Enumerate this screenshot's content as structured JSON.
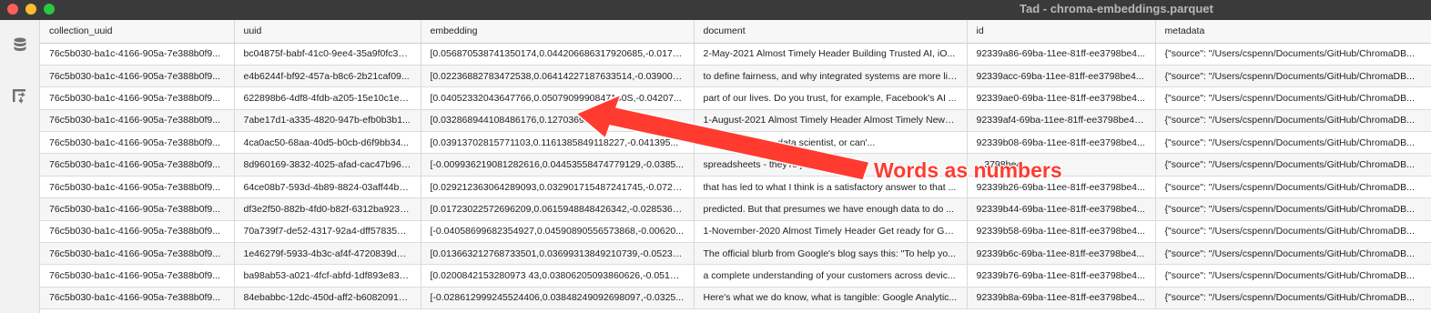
{
  "window": {
    "title": "Tad - chroma-embeddings.parquet"
  },
  "sidebar": {
    "icons": [
      "database-icon",
      "pivot-icon"
    ]
  },
  "table": {
    "columns": [
      "collection_uuid",
      "uuid",
      "embedding",
      "document",
      "id",
      "metadata"
    ],
    "rows": [
      [
        "76c5b030-ba1c-4166-905a-7e388b0f9...",
        "bc04875f-babf-41c0-9ee4-35a9f0fc33ea",
        "[0.056870538741350174,0.044206686317920685,-0.0179...",
        "2-May-2021 Almost Timely Header Building Trusted AI, iO...",
        "92339a86-69ba-11ee-81ff-ee3798be4...",
        "{\"source\": \"/Users/cspenn/Documents/GitHub/ChromaDB..."
      ],
      [
        "76c5b030-ba1c-4166-905a-7e388b0f9...",
        "e4b6244f-bf92-457a-b8c6-2b21caf09...",
        "[0.02236882783472538,0.06414227187633514,-0.039009...",
        "to define fairness, and why integrated systems are more lik...",
        "92339acc-69ba-11ee-81ff-ee3798be4...",
        "{\"source\": \"/Users/cspenn/Documents/GitHub/ChromaDB..."
      ],
      [
        "76c5b030-ba1c-4166-905a-7e388b0f9...",
        "622898b6-4df8-4fdb-a205-15e10c1e3...",
        "[0.04052332043647766,0.0507909990847140S,-0.04207...",
        "part of our lives. Do you trust, for example, Facebook's AI ...",
        "92339ae0-69ba-11ee-81ff-ee3798be4...",
        "{\"source\": \"/Users/cspenn/Documents/GitHub/ChromaDB..."
      ],
      [
        "76c5b030-ba1c-4166-905a-7e388b0f9...",
        "7abe17d1-a335-4820-947b-efb0b3b1...",
        "[0.032868944108486176,0.12703691...",
        "1-August-2021 Almost Timely Header Almost Timely News...",
        "92339af4-69ba-11ee-81ff-ee3798be4d...",
        "{\"source\": \"/Users/cspenn/Documents/GitHub/ChromaDB..."
      ],
      [
        "76c5b030-ba1c-4166-905a-7e388b0f9...",
        "4ca0ac50-68aa-40d5-b0cb-d6f9bb34...",
        "[0.03913702815771103,0.1161385849118227,-0.041395...",
        "...engineer and a data scientist, or can'...",
        "92339b08-69ba-11ee-81ff-ee3798be4...",
        "{\"source\": \"/Users/cspenn/Documents/GitHub/ChromaDB..."
      ],
      [
        "76c5b030-ba1c-4166-905a-7e388b0f9...",
        "8d960169-3832-4025-afad-cac47b964...",
        "[-0.009936219081282616,0.04453558474779129,-0.0385...",
        "spreadsheets - they're just ... my ev...",
        "...3798be4...",
        "{\"source\": \"/Users/cspenn/Documents/GitHub/ChromaDB..."
      ],
      [
        "76c5b030-ba1c-4166-905a-7e388b0f9...",
        "64ce08b7-593d-4b89-8824-03aff44be...",
        "[0.029212363064289093,0.032901715487241745,-0.0725...",
        "that has led to what I think is a satisfactory answer to that ...",
        "92339b26-69ba-11ee-81ff-ee3798be4...",
        "{\"source\": \"/Users/cspenn/Documents/GitHub/ChromaDB..."
      ],
      [
        "76c5b030-ba1c-4166-905a-7e388b0f9...",
        "df3e2f50-882b-4fd0-b82f-6312ba9234...",
        "[0.01723022572696209,0.0615948848426342,-0.0285362...",
        "predicted. But that presumes we have enough data to do ...",
        "92339b44-69ba-11ee-81ff-ee3798be4...",
        "{\"source\": \"/Users/cspenn/Documents/GitHub/ChromaDB..."
      ],
      [
        "76c5b030-ba1c-4166-905a-7e388b0f9...",
        "70a739f7-de52-4317-92a4-dff578353abf",
        "[-0.04058699682354927,0.04590890556573868,-0.00620...",
        "1-November-2020 Almost Timely Header Get ready for Go...",
        "92339b58-69ba-11ee-81ff-ee3798be4...",
        "{\"source\": \"/Users/cspenn/Documents/GitHub/ChromaDB..."
      ],
      [
        "76c5b030-ba1c-4166-905a-7e388b0f9...",
        "1e46279f-5933-4b3c-af4f-4720839d6df4",
        "[0.013663212768733501,0.03699313849210739,-0.05233...",
        "The official blurb from Google's blog says this: \"To help yo...",
        "92339b6c-69ba-11ee-81ff-ee3798be4...",
        "{\"source\": \"/Users/cspenn/Documents/GitHub/ChromaDB..."
      ],
      [
        "76c5b030-ba1c-4166-905a-7e388b0f9...",
        "ba98ab53-a021-4fcf-abfd-1df893e837dd",
        "[0.0200842153280973 43,0.03806205093860626,-0.05183...",
        "a complete understanding of your customers across devic...",
        "92339b76-69ba-11ee-81ff-ee3798be4...",
        "{\"source\": \"/Users/cspenn/Documents/GitHub/ChromaDB..."
      ],
      [
        "76c5b030-ba1c-4166-905a-7e388b0f9...",
        "84ebabbc-12dc-450d-aff2-b60820917...",
        "[-0.028612999245524406,0.03848249092698097,-0.0325...",
        "Here's what we do know, what is tangible: Google Analytic...",
        "92339b8a-69ba-11ee-81ff-ee3798be4...",
        "{\"source\": \"/Users/cspenn/Documents/GitHub/ChromaDB..."
      ]
    ]
  },
  "annotation": {
    "label": "Words as numbers",
    "color": "#ff3b30"
  }
}
